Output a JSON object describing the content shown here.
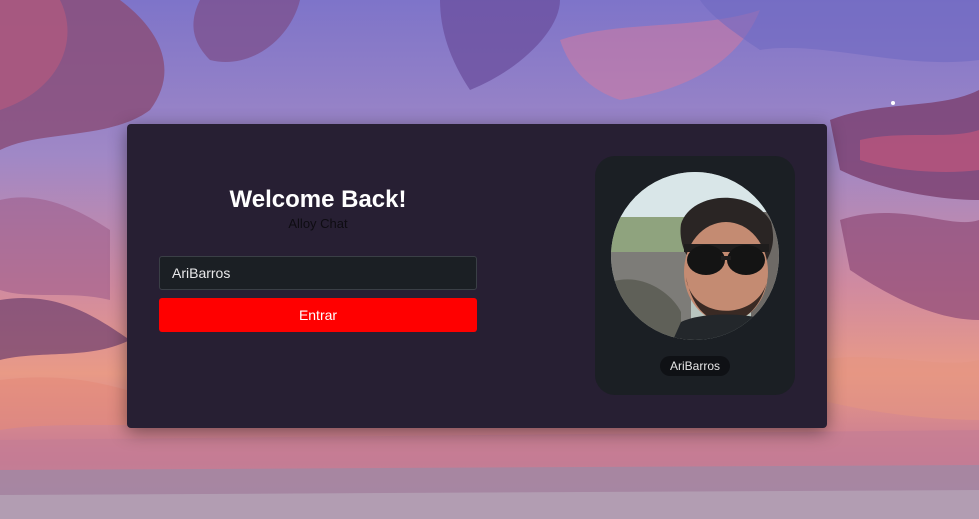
{
  "login": {
    "title": "Welcome Back!",
    "subtitle": "Alloy Chat",
    "username_value": "AriBarros",
    "enter_label": "Entrar"
  },
  "profile": {
    "display_name": "AriBarros",
    "avatar_icon": "user-avatar-photo"
  },
  "colors": {
    "card_background": "#271f33",
    "input_background": "#1b1f24",
    "accent_button": "#ff0000",
    "text_primary": "#ffffff"
  }
}
